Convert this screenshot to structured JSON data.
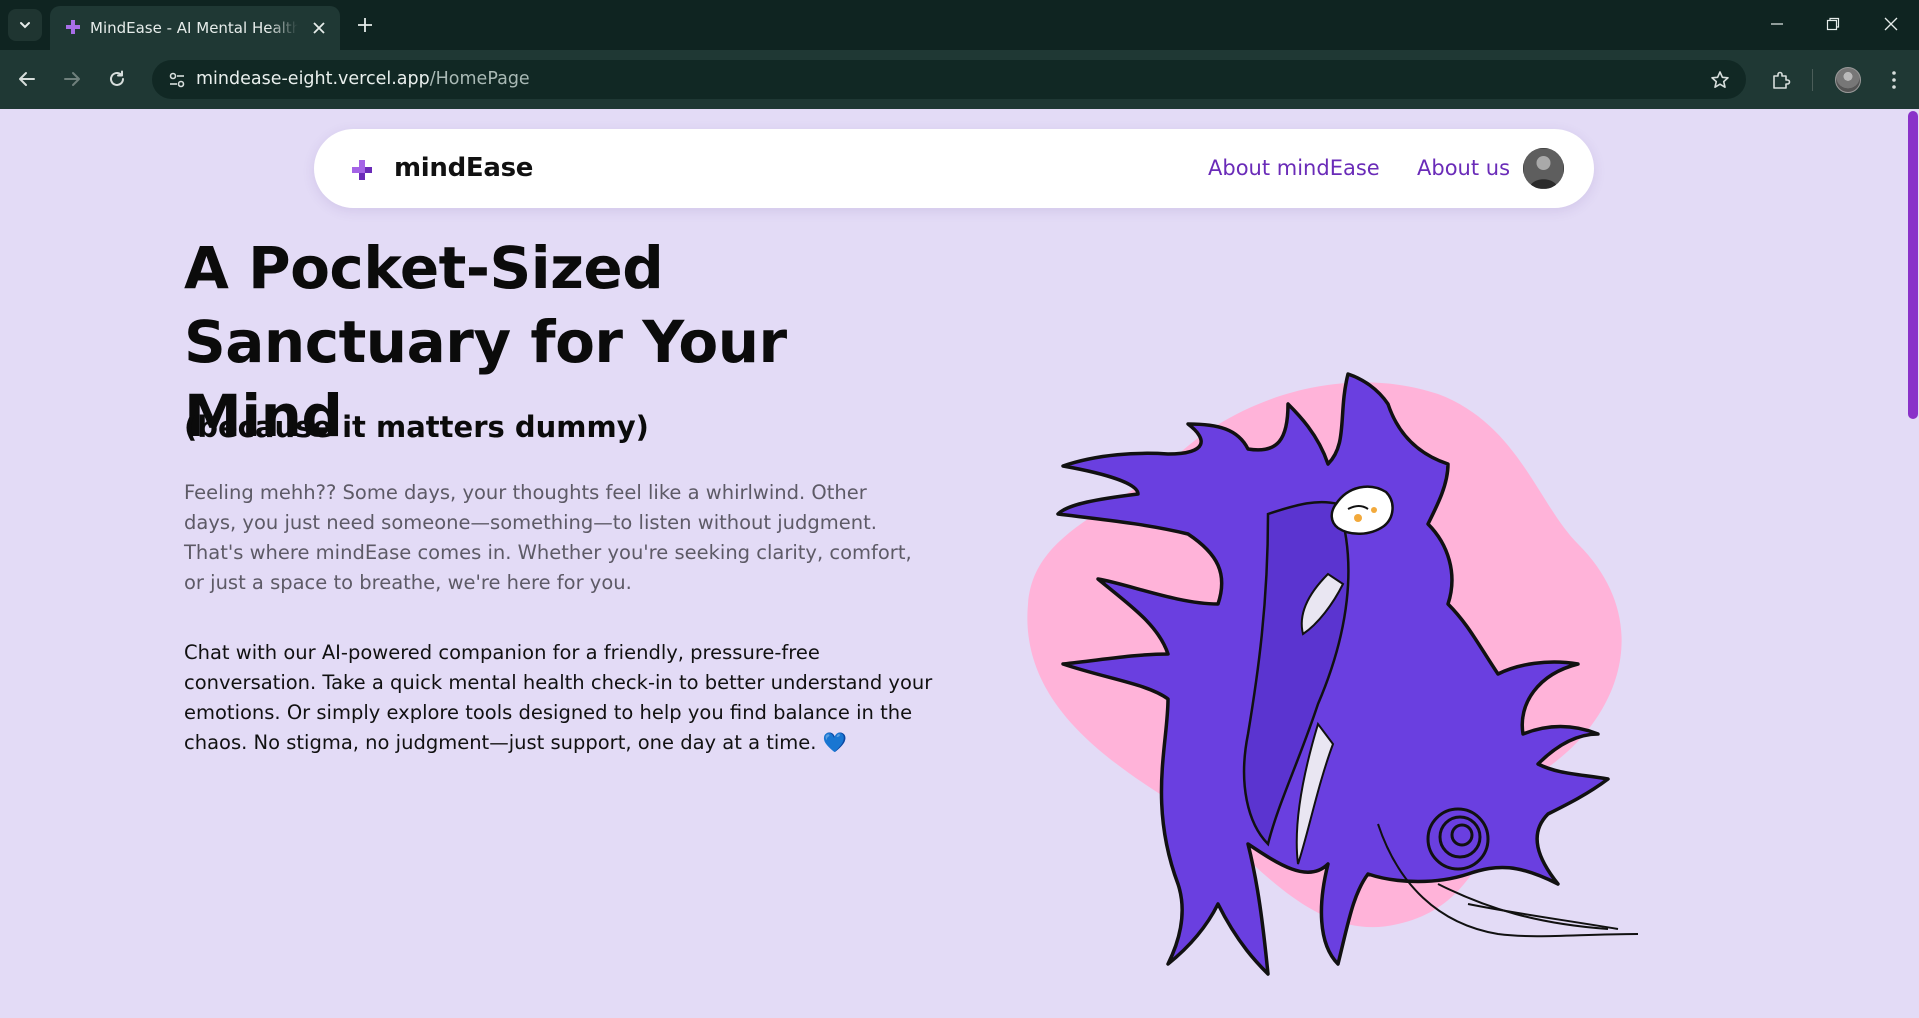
{
  "browser": {
    "tab_title": "MindEase - AI Mental Health Assistant",
    "url_host": "mindease-eight.vercel.app",
    "url_path": "/HomePage",
    "icons": {
      "tab_list": "chevron-down-icon",
      "favicon": "mindease-plus-icon",
      "tab_close": "close-icon",
      "new_tab": "plus-icon",
      "back": "back-arrow-icon",
      "forward": "forward-arrow-icon",
      "reload": "reload-icon",
      "site_info": "site-settings-icon",
      "bookmark": "star-icon",
      "extensions": "puzzle-icon",
      "profile": "avatar",
      "menu": "kebab-menu-icon",
      "minimize": "minimize-icon",
      "restore": "restore-icon",
      "close_window": "close-icon"
    }
  },
  "navbar": {
    "brand": "mindEase",
    "links": [
      "About mindEase",
      "About us"
    ],
    "logo_icon": "plus-logo-icon"
  },
  "hero": {
    "title": "A Pocket-Sized Sanctuary for Your Mind",
    "subtitle": "(because it matters dummy)",
    "intro": "Feeling mehh?? Some days, your thoughts feel like a whirlwind. Other days, you just need someone—something—to listen without judgment. That's where mindEase comes in. Whether you're seeking clarity, comfort, or just a space to breathe, we're here for you.",
    "pitch": "Chat with our AI-powered companion for a friendly, pressure-free conversation. Take a quick mental health check-in to better understand your emotions. Or simply explore tools designed to help you find balance in the chaos. No stigma, no judgment—just support, one day at a time.",
    "pitch_emoji": "💙"
  },
  "colors": {
    "page_bg": "#e3dbf6",
    "brand_purple": "#6a2bb8",
    "illustration_purple": "#6a3fe0",
    "illustration_pink": "#ffb3d9",
    "scrollbar": "#8a31c9"
  }
}
